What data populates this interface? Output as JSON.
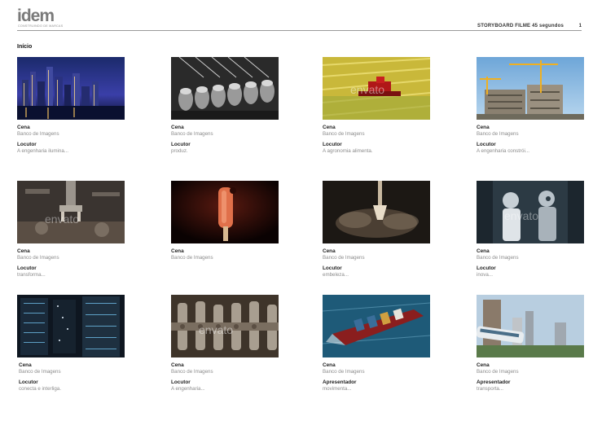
{
  "header": {
    "logo": "idem",
    "logo_tagline": "CONSTRUINDO DE MARCAS",
    "title": "STORYBOARD FILME 45 segundos",
    "page": "1"
  },
  "section": "Início",
  "watermark_text": "envato",
  "frames": [
    {
      "scene_label": "Cena",
      "scene_value": "Banco de Imagens",
      "voice_label": "Locutor",
      "voice_text": "A engenharia ilumina..."
    },
    {
      "scene_label": "Cena",
      "scene_value": "Banco de Imagens",
      "voice_label": "Locutor",
      "voice_text": "produz."
    },
    {
      "scene_label": "Cena",
      "scene_value": "Banco de Imagens",
      "voice_label": "Locutor",
      "voice_text": "A agronomia alimenta."
    },
    {
      "scene_label": "Cena",
      "scene_value": "Banco de Imagens",
      "voice_label": "Locutor",
      "voice_text": "A engenharia constrói..."
    },
    {
      "scene_label": "Cena",
      "scene_value": "Banco de Imagens",
      "voice_label": "Locutor",
      "voice_text": "transforma..."
    },
    {
      "scene_label": "Cena",
      "scene_value": "Banco de Imagens",
      "voice_label": "",
      "voice_text": ""
    },
    {
      "scene_label": "Cena",
      "scene_value": "Banco de Imagens",
      "voice_label": "Locutor",
      "voice_text": "embeleza..."
    },
    {
      "scene_label": "Cena",
      "scene_value": "Banco de Imagens",
      "voice_label": "Locutor",
      "voice_text": "inova..."
    },
    {
      "scene_label": "Cena",
      "scene_value": "Banco de Imagens",
      "voice_label": "Locutor",
      "voice_text": "conecta e interliga."
    },
    {
      "scene_label": "Cena",
      "scene_value": "Banco de Imagens",
      "voice_label": "Locutor",
      "voice_text": "A engenharia..."
    },
    {
      "scene_label": "Cena",
      "scene_value": "Banco de Imagens",
      "voice_label": "Apresentador",
      "voice_text": "movimenta..."
    },
    {
      "scene_label": "Cena",
      "scene_value": "Banco de Imagens",
      "voice_label": "Apresentador",
      "voice_text": "transporta..."
    }
  ]
}
